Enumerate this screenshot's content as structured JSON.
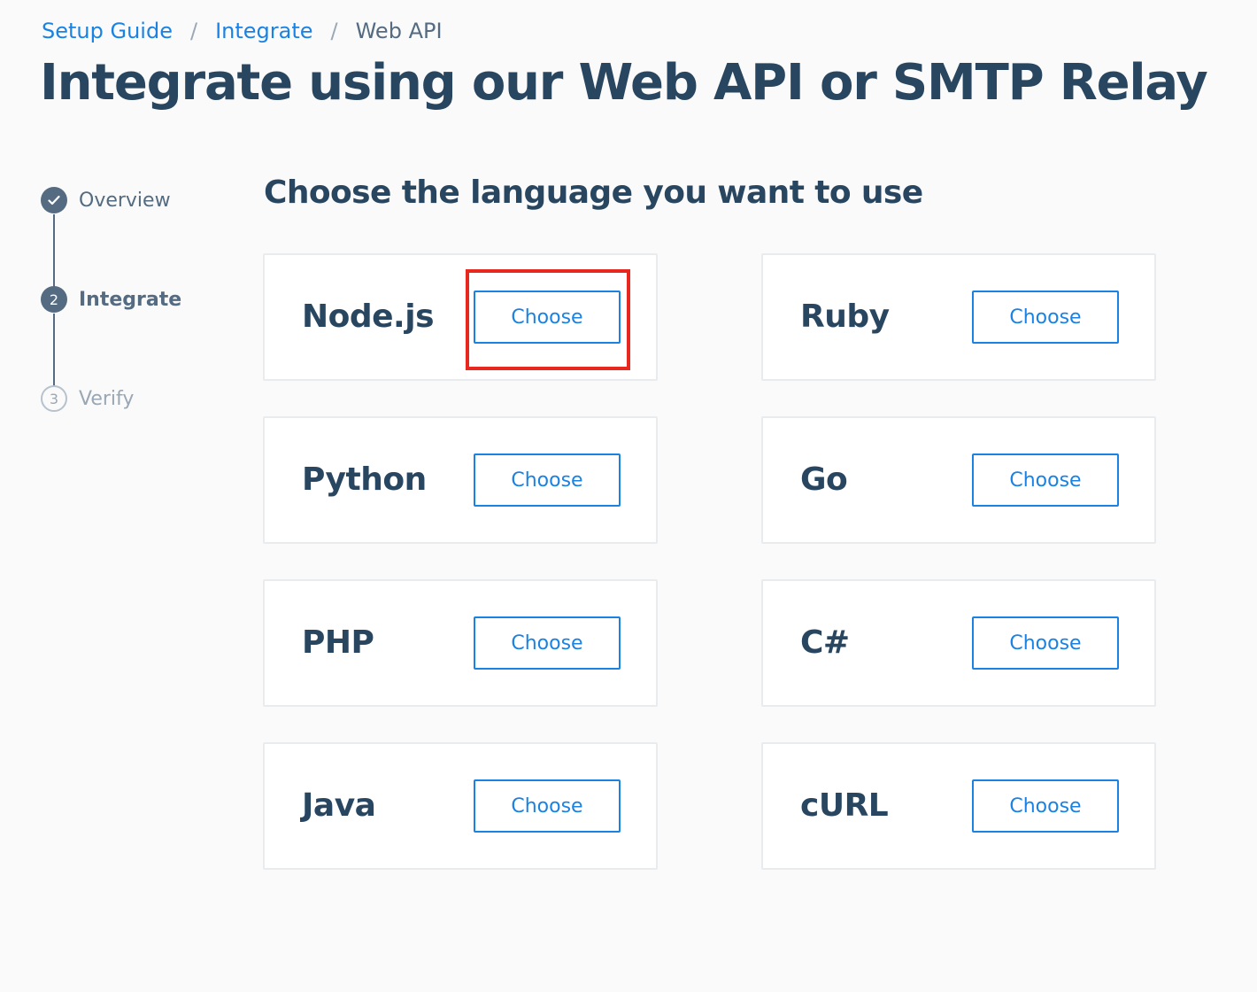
{
  "breadcrumb": {
    "items": [
      {
        "label": "Setup Guide",
        "link": true
      },
      {
        "label": "Integrate",
        "link": true
      },
      {
        "label": "Web API",
        "link": false
      }
    ],
    "separator": "/"
  },
  "page_title": "Integrate using our Web API or SMTP Relay",
  "stepper": {
    "steps": [
      {
        "number": "1",
        "label": "Overview",
        "state": "completed",
        "icon": "check-icon"
      },
      {
        "number": "2",
        "label": "Integrate",
        "state": "active"
      },
      {
        "number": "3",
        "label": "Verify",
        "state": "pending"
      }
    ]
  },
  "section_heading": "Choose the language you want to use",
  "languages": [
    {
      "name": "Node.js",
      "button_label": "Choose",
      "highlighted": true
    },
    {
      "name": "Ruby",
      "button_label": "Choose"
    },
    {
      "name": "Python",
      "button_label": "Choose"
    },
    {
      "name": "Go",
      "button_label": "Choose"
    },
    {
      "name": "PHP",
      "button_label": "Choose"
    },
    {
      "name": "C#",
      "button_label": "Choose"
    },
    {
      "name": "Java",
      "button_label": "Choose"
    },
    {
      "name": "cURL",
      "button_label": "Choose"
    }
  ],
  "colors": {
    "accent": "#1a82e2",
    "heading": "#294661",
    "muted": "#546b81",
    "highlight": "#e8281f"
  }
}
